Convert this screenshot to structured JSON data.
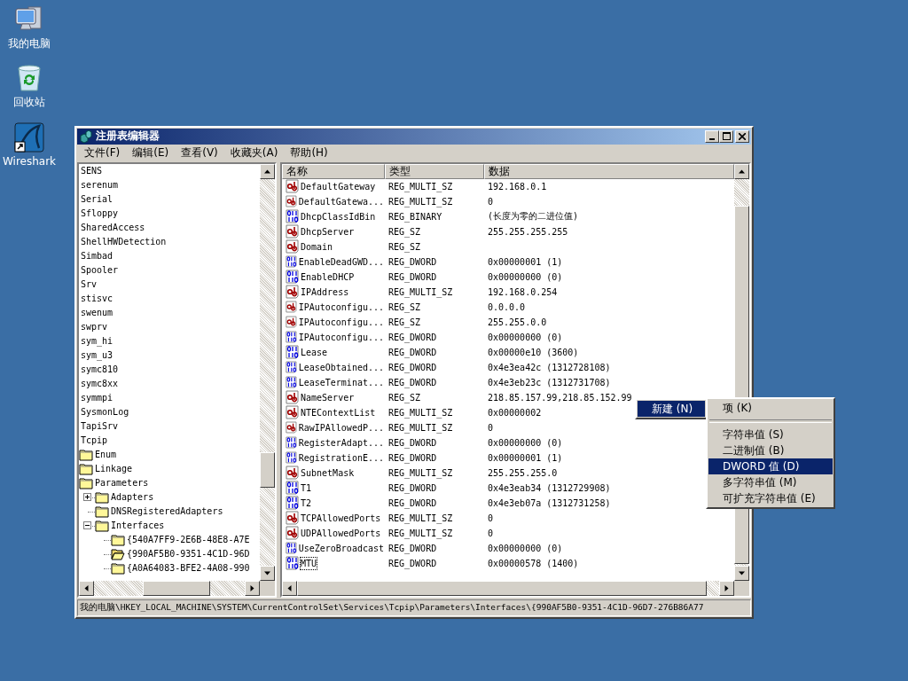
{
  "desktop_icons": [
    {
      "kind": "computer",
      "label": "我的电脑"
    },
    {
      "kind": "recycle",
      "label": "回收站"
    },
    {
      "kind": "wireshark",
      "label": "Wireshark"
    }
  ],
  "window": {
    "title": "注册表编辑器"
  },
  "menu": [
    {
      "label": "文件(F)"
    },
    {
      "label": "编辑(E)"
    },
    {
      "label": "查看(V)"
    },
    {
      "label": "收藏夹(A)"
    },
    {
      "label": "帮助(H)"
    }
  ],
  "tree": [
    {
      "label": "SENS"
    },
    {
      "label": "serenum"
    },
    {
      "label": "Serial"
    },
    {
      "label": "Sfloppy"
    },
    {
      "label": "SharedAccess"
    },
    {
      "label": "ShellHWDetection"
    },
    {
      "label": "Simbad"
    },
    {
      "label": "Spooler"
    },
    {
      "label": "Srv"
    },
    {
      "label": "stisvc"
    },
    {
      "label": "swenum"
    },
    {
      "label": "swprv"
    },
    {
      "label": "sym_hi"
    },
    {
      "label": "sym_u3"
    },
    {
      "label": "symc810"
    },
    {
      "label": "symc8xx"
    },
    {
      "label": "symmpi"
    },
    {
      "label": "SysmonLog"
    },
    {
      "label": "TapiSrv"
    },
    {
      "label": "Tcpip",
      "children": [
        {
          "label": "Enum"
        },
        {
          "label": "Linkage"
        },
        {
          "label": "Parameters",
          "children": [
            {
              "label": "Adapters",
              "expanded": false
            },
            {
              "label": "DNSRegisteredAdapters"
            },
            {
              "label": "Interfaces",
              "expanded": true,
              "children": [
                {
                  "label": "{540A7FF9-2E6B-48E8-A7E",
                  "selected": false
                },
                {
                  "label": "{990AF5B0-9351-4C1D-96D",
                  "selected": true
                },
                {
                  "label": "{A0A64083-BFE2-4A08-990",
                  "selected": false
                }
              ]
            }
          ]
        }
      ]
    }
  ],
  "columns": [
    "名称",
    "类型",
    "数据"
  ],
  "rows": [
    {
      "kind": "string",
      "name": "DefaultGateway",
      "type": "REG_MULTI_SZ",
      "data": "192.168.0.1",
      "focused": false
    },
    {
      "kind": "string",
      "name": "DefaultGatewa...",
      "type": "REG_MULTI_SZ",
      "data": "0",
      "focused": false
    },
    {
      "kind": "binary",
      "name": "DhcpClassIdBin",
      "type": "REG_BINARY",
      "data": "(长度为零的二进位值)",
      "focused": false
    },
    {
      "kind": "string",
      "name": "DhcpServer",
      "type": "REG_SZ",
      "data": "255.255.255.255",
      "focused": false
    },
    {
      "kind": "string",
      "name": "Domain",
      "type": "REG_SZ",
      "focused": false
    },
    {
      "kind": "binary",
      "name": "EnableDeadGWD...",
      "type": "REG_DWORD",
      "data": "0x00000001 (1)",
      "focused": false
    },
    {
      "kind": "binary",
      "name": "EnableDHCP",
      "type": "REG_DWORD",
      "data": "0x00000000 (0)",
      "focused": false
    },
    {
      "kind": "string",
      "name": "IPAddress",
      "type": "REG_MULTI_SZ",
      "data": "192.168.0.254",
      "focused": false
    },
    {
      "kind": "string",
      "name": "IPAutoconfigu...",
      "type": "REG_SZ",
      "data": "0.0.0.0",
      "focused": false
    },
    {
      "kind": "string",
      "name": "IPAutoconfigu...",
      "type": "REG_SZ",
      "data": "255.255.0.0",
      "focused": false
    },
    {
      "kind": "binary",
      "name": "IPAutoconfigu...",
      "type": "REG_DWORD",
      "data": "0x00000000 (0)",
      "focused": false
    },
    {
      "kind": "binary",
      "name": "Lease",
      "type": "REG_DWORD",
      "data": "0x00000e10 (3600)",
      "focused": false
    },
    {
      "kind": "binary",
      "name": "LeaseObtained...",
      "type": "REG_DWORD",
      "data": "0x4e3ea42c (1312728108)",
      "focused": false
    },
    {
      "kind": "binary",
      "name": "LeaseTerminat...",
      "type": "REG_DWORD",
      "data": "0x4e3eb23c (1312731708)",
      "focused": false
    },
    {
      "kind": "string",
      "name": "NameServer",
      "type": "REG_SZ",
      "data": "218.85.157.99,218.85.152.99",
      "focused": false
    },
    {
      "kind": "string",
      "name": "NTEContextList",
      "type": "REG_MULTI_SZ",
      "data": "0x00000002",
      "focused": false
    },
    {
      "kind": "string",
      "name": "RawIPAllowedP...",
      "type": "REG_MULTI_SZ",
      "data": "0",
      "focused": false
    },
    {
      "kind": "binary",
      "name": "RegisterAdapt...",
      "type": "REG_DWORD",
      "data": "0x00000000 (0)",
      "focused": false
    },
    {
      "kind": "binary",
      "name": "RegistrationE...",
      "type": "REG_DWORD",
      "data": "0x00000001 (1)",
      "focused": false
    },
    {
      "kind": "string",
      "name": "SubnetMask",
      "type": "REG_MULTI_SZ",
      "data": "255.255.255.0",
      "focused": false
    },
    {
      "kind": "binary",
      "name": "T1",
      "type": "REG_DWORD",
      "data": "0x4e3eab34 (1312729908)",
      "focused": false
    },
    {
      "kind": "binary",
      "name": "T2",
      "type": "REG_DWORD",
      "data": "0x4e3eb07a (1312731258)",
      "focused": false
    },
    {
      "kind": "string",
      "name": "TCPAllowedPorts",
      "type": "REG_MULTI_SZ",
      "data": "0",
      "focused": false
    },
    {
      "kind": "string",
      "name": "UDPAllowedPorts",
      "type": "REG_MULTI_SZ",
      "data": "0",
      "focused": false
    },
    {
      "kind": "binary",
      "name": "UseZeroBroadcast",
      "type": "REG_DWORD",
      "data": "0x00000000 (0)",
      "focused": false
    },
    {
      "kind": "binary",
      "name": "MTU",
      "type": "REG_DWORD",
      "data": "0x00000578 (1400)",
      "focused": true
    }
  ],
  "status_bar": "我的电脑\\HKEY_LOCAL_MACHINE\\SYSTEM\\CurrentControlSet\\Services\\Tcpip\\Parameters\\Interfaces\\{990AF5B0-9351-4C1D-96D7-276B86A77",
  "context_menu": {
    "items": [
      {
        "label": "新建 (N)",
        "selected": true
      }
    ],
    "submenu": [
      {
        "kind": "item",
        "label": "项 (K)",
        "selected": false
      },
      {
        "kind": "separator"
      },
      {
        "kind": "item",
        "label": "字符串值 (S)",
        "selected": false
      },
      {
        "kind": "item",
        "label": "二进制值 (B)",
        "selected": false
      },
      {
        "kind": "item",
        "label": "DWORD 值 (D)",
        "selected": true
      },
      {
        "kind": "item",
        "label": "多字符串值 (M)",
        "selected": false
      },
      {
        "kind": "item",
        "label": "可扩充字符串值 (E)",
        "selected": false
      }
    ]
  }
}
